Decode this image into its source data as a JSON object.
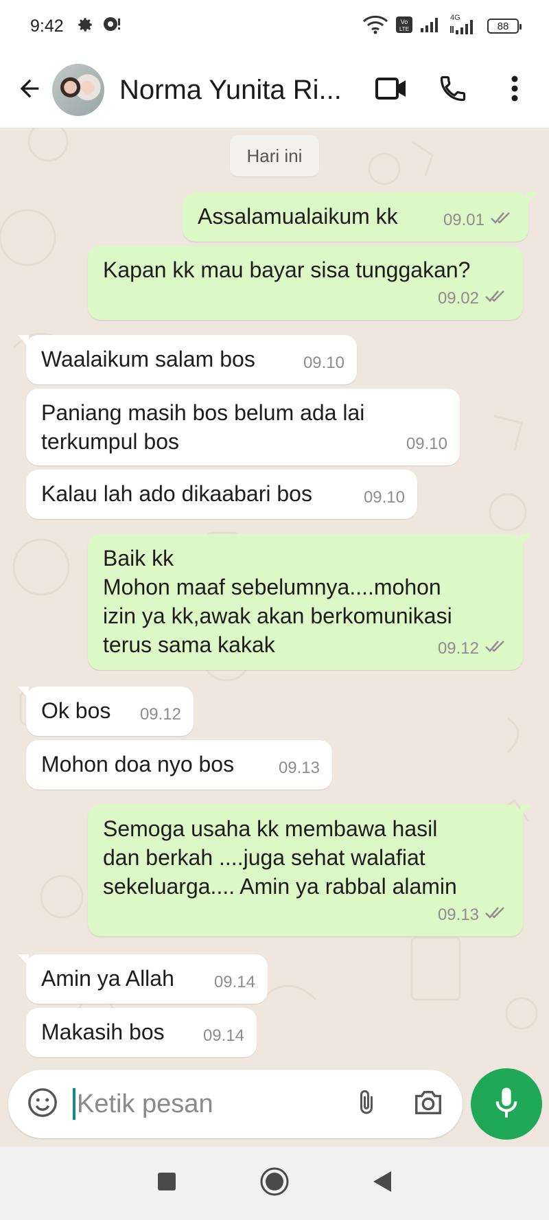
{
  "status_bar": {
    "time": "9:42",
    "battery": "88",
    "network_label": "4G"
  },
  "header": {
    "contact_name": "Norma Yunita Ri..."
  },
  "chat": {
    "date_label": "Hari ini",
    "messages": [
      {
        "direction": "out",
        "text": "Assalamualaikum kk",
        "time": "09.01",
        "read": true
      },
      {
        "direction": "out",
        "text": "Kapan kk mau bayar sisa tunggakan?",
        "time": "09.02",
        "read": true
      },
      {
        "direction": "in",
        "text": "Waalaikum salam bos",
        "time": "09.10"
      },
      {
        "direction": "in",
        "text": "Paniang masih bos belum ada lai\nterkumpul bos",
        "time": "09.10"
      },
      {
        "direction": "in",
        "text": "Kalau lah ado dikaabari bos",
        "time": "09.10"
      },
      {
        "direction": "out",
        "text": "Baik kk\nMohon maaf sebelumnya....mohon\nizin ya kk,awak akan berkomunikasi\nterus sama kakak",
        "time": "09.12",
        "read": true
      },
      {
        "direction": "in",
        "text": "Ok bos",
        "time": "09.12"
      },
      {
        "direction": "in",
        "text": "Mohon doa nyo bos",
        "time": "09.13"
      },
      {
        "direction": "out",
        "text": "Semoga usaha kk membawa hasil\ndan berkah ....juga sehat walafiat\nsekeluarga.... Amin ya rabbal alamin",
        "time": "09.13",
        "read": true
      },
      {
        "direction": "in",
        "text": "Amin ya Allah",
        "time": "09.14"
      },
      {
        "direction": "in",
        "text": "Makasih bos",
        "time": "09.14"
      }
    ]
  },
  "composer": {
    "placeholder": "Ketik pesan"
  },
  "colors": {
    "outgoing_bubble": "#dcf8c6",
    "incoming_bubble": "#ffffff",
    "chat_background": "#efe7dd",
    "accent": "#1fa855",
    "read_tick": "#8d8d8d"
  },
  "icons": [
    "settings-icon",
    "notification-icon",
    "wifi-icon",
    "volte-icon",
    "signal-icon",
    "battery-icon",
    "back-arrow-icon",
    "video-call-icon",
    "phone-icon",
    "more-vert-icon",
    "double-check-icon",
    "emoji-icon",
    "attach-icon",
    "camera-icon",
    "mic-icon",
    "nav-recents-icon",
    "nav-home-icon",
    "nav-back-icon"
  ]
}
